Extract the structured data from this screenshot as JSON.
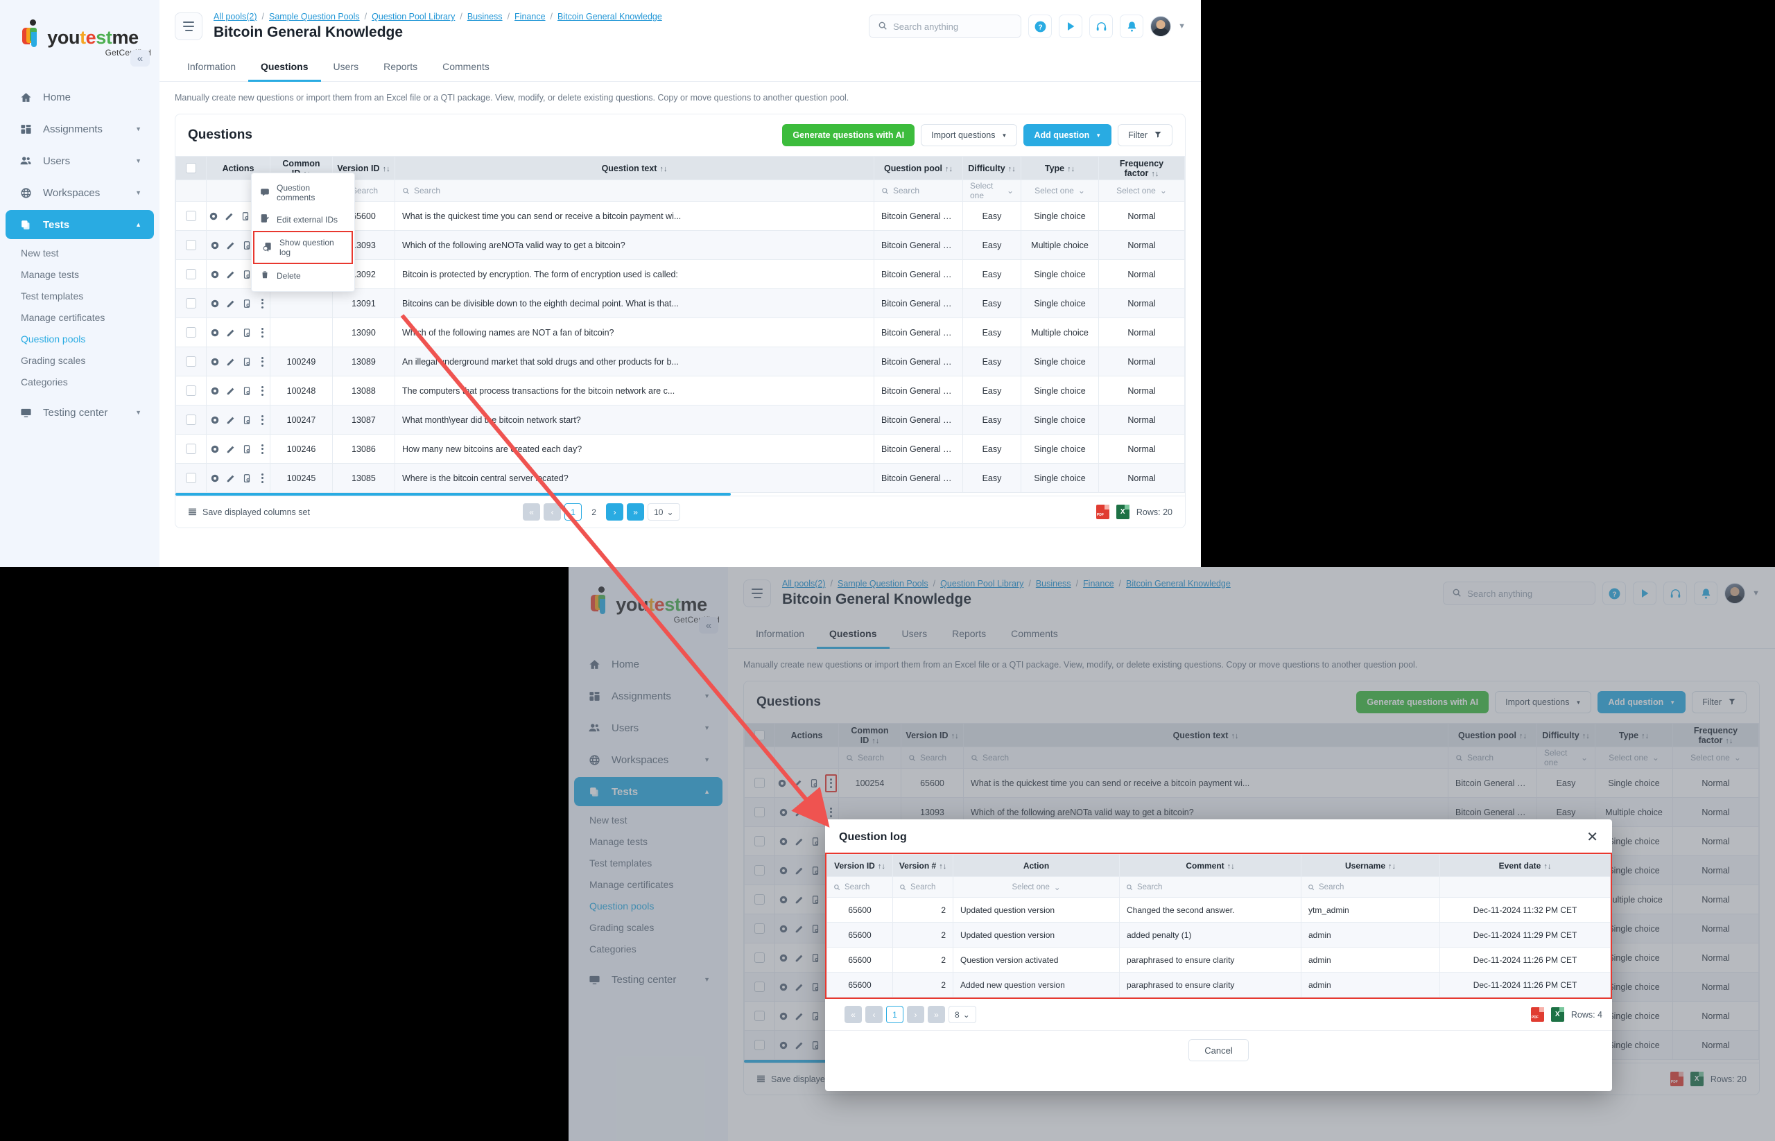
{
  "brand": {
    "name_parts": [
      "you",
      "t",
      "e",
      "st",
      "me"
    ],
    "tagline": "GetCertified",
    "collapse_icon": "«"
  },
  "sidebar": {
    "items": [
      {
        "label": "Home",
        "icon": "home-icon",
        "caret": ""
      },
      {
        "label": "Assignments",
        "icon": "assignments-icon",
        "caret": "▼"
      },
      {
        "label": "Users",
        "icon": "users-icon",
        "caret": "▼"
      },
      {
        "label": "Workspaces",
        "icon": "globe-icon",
        "caret": "▼"
      },
      {
        "label": "Tests",
        "icon": "tests-icon",
        "caret": "▲",
        "active": true
      }
    ],
    "sub_items": [
      {
        "label": "New test"
      },
      {
        "label": "Manage tests"
      },
      {
        "label": "Test templates"
      },
      {
        "label": "Manage certificates"
      },
      {
        "label": "Question pools",
        "current": true
      },
      {
        "label": "Grading scales"
      },
      {
        "label": "Categories"
      }
    ],
    "trailing_items": [
      {
        "label": "Testing center",
        "icon": "testing-center-icon",
        "caret": "▼"
      }
    ]
  },
  "topbar": {
    "breadcrumb": [
      "All pools(2)",
      "Sample Question Pools",
      "Question Pool Library",
      "Business",
      "Finance",
      "Bitcoin General Knowledge"
    ],
    "breadcrumb_sep": "/",
    "page_title": "Bitcoin General Knowledge",
    "search_placeholder": "Search anything",
    "icons": [
      "help-icon",
      "play-icon",
      "headset-icon",
      "bell-icon",
      "avatar",
      "chevron-down-icon"
    ]
  },
  "tabs": [
    {
      "label": "Information",
      "active": false
    },
    {
      "label": "Questions",
      "active": true
    },
    {
      "label": "Users",
      "active": false
    },
    {
      "label": "Reports",
      "active": false
    },
    {
      "label": "Comments",
      "active": false
    }
  ],
  "hint": "Manually create new questions or import them from an Excel file or a QTI package. View, modify, or delete existing questions. Copy or move questions to another question pool.",
  "card": {
    "title": "Questions",
    "buttons": {
      "generate": "Generate questions with AI",
      "import": "Import questions",
      "add": "Add question",
      "filter": "Filter",
      "caret": "▼"
    }
  },
  "table": {
    "columns": [
      {
        "label": "",
        "sort": false
      },
      {
        "label": "Actions",
        "sort": false
      },
      {
        "label": "Common ID",
        "sort": true
      },
      {
        "label": "Version ID",
        "sort": true
      },
      {
        "label": "Question text",
        "sort": true
      },
      {
        "label": "Question pool",
        "sort": true
      },
      {
        "label": "Difficulty",
        "sort": true
      },
      {
        "label": "Type",
        "sort": true
      },
      {
        "label": "Frequency factor",
        "sort": true
      }
    ],
    "sort_glyph": "↑↓",
    "filters": {
      "search_placeholder": "Search",
      "select_placeholder": "Select one",
      "select_caret": "⌄"
    },
    "rows": [
      {
        "common_id": "100254",
        "version_id": "65600",
        "question_text": "What is the quickest time you can send or receive a bitcoin payment wi...",
        "pool": "Bitcoin General Kno...",
        "difficulty": "Easy",
        "type": "Single choice",
        "frequency": "Normal"
      },
      {
        "common_id": "",
        "version_id": "13093",
        "question_text": "Which of the following areNOTa valid way to get a bitcoin?",
        "pool": "Bitcoin General Kno...",
        "difficulty": "Easy",
        "type": "Multiple choice",
        "frequency": "Normal"
      },
      {
        "common_id": "",
        "version_id": "13092",
        "question_text": "Bitcoin is protected by encryption. The form of encryption used is called:",
        "pool": "Bitcoin General Kno...",
        "difficulty": "Easy",
        "type": "Single choice",
        "frequency": "Normal"
      },
      {
        "common_id": "",
        "version_id": "13091",
        "question_text": "Bitcoins can be divisible down to the eighth decimal point. What is that...",
        "pool": "Bitcoin General Kno...",
        "difficulty": "Easy",
        "type": "Single choice",
        "frequency": "Normal"
      },
      {
        "common_id": "",
        "version_id": "13090",
        "question_text": "Which of the following names are NOT a fan of bitcoin?",
        "pool": "Bitcoin General Kno...",
        "difficulty": "Easy",
        "type": "Multiple choice",
        "frequency": "Normal"
      },
      {
        "common_id": "100249",
        "version_id": "13089",
        "question_text": "An illegal underground market that sold drugs and other products for b...",
        "pool": "Bitcoin General Kno...",
        "difficulty": "Easy",
        "type": "Single choice",
        "frequency": "Normal"
      },
      {
        "common_id": "100248",
        "version_id": "13088",
        "question_text": "The computers that process transactions for the bitcoin network are c...",
        "pool": "Bitcoin General Kno...",
        "difficulty": "Easy",
        "type": "Single choice",
        "frequency": "Normal"
      },
      {
        "common_id": "100247",
        "version_id": "13087",
        "question_text": "What month\\year did the bitcoin network start?",
        "pool": "Bitcoin General Kno...",
        "difficulty": "Easy",
        "type": "Single choice",
        "frequency": "Normal"
      },
      {
        "common_id": "100246",
        "version_id": "13086",
        "question_text": "How many new bitcoins are created each day?",
        "pool": "Bitcoin General Kno...",
        "difficulty": "Easy",
        "type": "Single choice",
        "frequency": "Normal"
      },
      {
        "common_id": "100245",
        "version_id": "13085",
        "question_text": "Where is the bitcoin central server located?",
        "pool": "Bitcoin General Kno...",
        "difficulty": "Easy",
        "type": "Single choice",
        "frequency": "Normal"
      }
    ]
  },
  "context_menu": {
    "items": [
      {
        "label": "Question comments",
        "icon": "comment-icon",
        "highlighted": false
      },
      {
        "label": "Edit external IDs",
        "icon": "edit-document-icon",
        "highlighted": false
      },
      {
        "label": "Show question log",
        "icon": "log-search-icon",
        "highlighted": true
      },
      {
        "label": "Delete",
        "icon": "trash-icon",
        "highlighted": false
      }
    ]
  },
  "footer": {
    "save_columns": "Save displayed columns set",
    "pager": {
      "first": "«",
      "prev": "‹",
      "pages": [
        "1",
        "2"
      ],
      "current": "1",
      "next": "›",
      "last": "»",
      "page_size": "10",
      "page_size_caret": "⌄"
    },
    "export": [
      "pdf-export-icon",
      "excel-export-icon"
    ],
    "rows_label": "Rows: 20"
  },
  "modal": {
    "title": "Question log",
    "close_icon": "✕",
    "columns": [
      {
        "label": "Version ID",
        "sort": true
      },
      {
        "label": "Version #",
        "sort": true
      },
      {
        "label": "Action",
        "sort": false
      },
      {
        "label": "Comment",
        "sort": true
      },
      {
        "label": "Username",
        "sort": true
      },
      {
        "label": "Event date",
        "sort": true
      }
    ],
    "sort_glyph": "↑↓",
    "filters": {
      "search_placeholder": "Search",
      "select_placeholder": "Select one",
      "select_caret": "⌄"
    },
    "rows": [
      {
        "version_id": "65600",
        "version_num": "2",
        "action": "Updated question version",
        "comment": "Changed the second answer.",
        "username": "ytm_admin",
        "event_date": "Dec-11-2024 11:32 PM CET"
      },
      {
        "version_id": "65600",
        "version_num": "2",
        "action": "Updated question version",
        "comment": "added penalty (1)",
        "username": "admin",
        "event_date": "Dec-11-2024 11:29 PM CET"
      },
      {
        "version_id": "65600",
        "version_num": "2",
        "action": "Question version activated",
        "comment": "paraphrased to ensure clarity",
        "username": "admin",
        "event_date": "Dec-11-2024 11:26 PM CET"
      },
      {
        "version_id": "65600",
        "version_num": "2",
        "action": "Added new question version",
        "comment": "paraphrased to ensure clarity",
        "username": "admin",
        "event_date": "Dec-11-2024 11:26 PM CET"
      }
    ],
    "pager": {
      "first": "«",
      "prev": "‹",
      "current": "1",
      "next": "›",
      "last": "»",
      "page_size": "8",
      "page_size_caret": "⌄"
    },
    "export": [
      "pdf-export-icon",
      "excel-export-icon"
    ],
    "rows_label": "Rows: 4",
    "cancel_label": "Cancel"
  },
  "colors": {
    "accent": "#29abe2",
    "green": "#3cbc3c",
    "annotation": "#ef5350",
    "header_gray": "#dfe4ea"
  }
}
